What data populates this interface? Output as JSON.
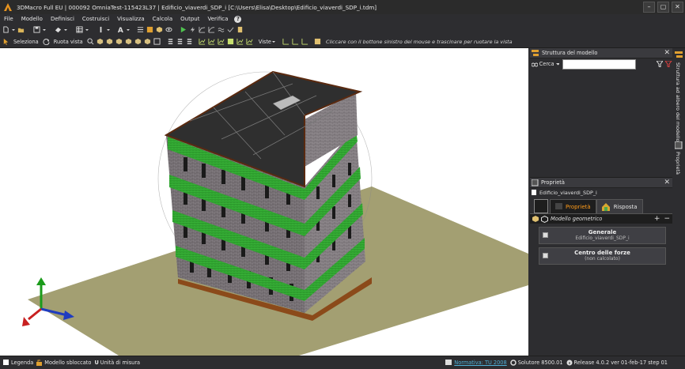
{
  "window": {
    "title": "3DMacro Full EU | 000092 OmniaTest-115423L37 | Edificio_viaverdi_SDP_i [C:\\Users\\Elisa\\Desktop\\Edificio_viaverdi_SDP_i.tdm]",
    "minimize": "–",
    "maximize": "▢",
    "close": "✕"
  },
  "menu": [
    "File",
    "Modello",
    "Definisci",
    "Costruisci",
    "Visualizza",
    "Calcola",
    "Output",
    "Verifica"
  ],
  "help_label": "?",
  "toolbar2": {
    "select_label": "Seleziona",
    "rotate_label": "Ruota vista",
    "views_label": "Viste",
    "hint": "Cliccare con il bottone sinistro del mouse e trascinare per ruotare la vista"
  },
  "model_tree": {
    "title": "Struttura del modello",
    "search_label": "Cerca",
    "search_value": ""
  },
  "properties": {
    "title": "Proprietà",
    "object_name": "Edificio_viaverdi_SDP_i",
    "tabs": [
      {
        "label": "Proprietà",
        "active": true
      },
      {
        "label": "Risposta",
        "active": false
      }
    ],
    "section_label": "Modello geometrico",
    "plus": "+",
    "minus": "−",
    "groups": [
      {
        "title": "Generale",
        "subtitle": "Edificio_viaverdi_SDP_i"
      },
      {
        "title": "Centro delle forze",
        "subtitle": "(non calcolato)"
      }
    ]
  },
  "side_tabs": [
    "Struttura ad albero del modello",
    "Proprietà"
  ],
  "status": {
    "legend": "Legenda",
    "model_state": "Modello sbloccato",
    "units": "Unità di misura",
    "norm": "Normativa: TU 2008",
    "solver": "Solutore 8500.01",
    "release": "Release 4.0.2 ver 01-feb-17 step 01"
  },
  "colors": {
    "accent_orange": "#ff9c1a",
    "link_blue": "#4fb0d8",
    "ground": "#a39f72",
    "roof": "#2f2f2f",
    "green_band": "#2e9d2e",
    "masonry": "#7a7478"
  }
}
